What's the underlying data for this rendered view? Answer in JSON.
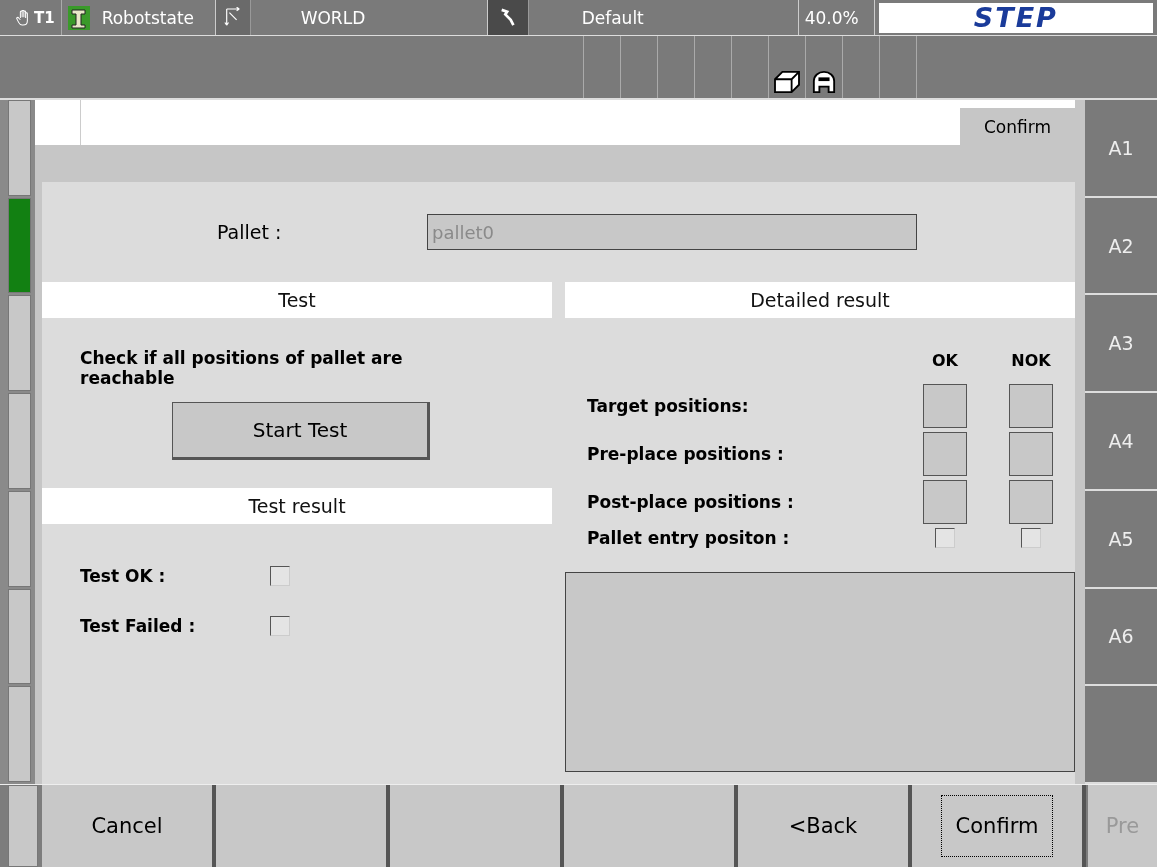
{
  "status_bar": {
    "mode": "T1",
    "robot_state": "Robotstate",
    "coordinate_system": "WORLD",
    "tool": "Default",
    "speed": "40.0%",
    "logo": "STEP"
  },
  "left_strip": [
    {
      "selected": false
    },
    {
      "selected": true
    },
    {
      "selected": false
    },
    {
      "selected": false
    },
    {
      "selected": false
    },
    {
      "selected": false
    },
    {
      "selected": false
    }
  ],
  "header": {
    "confirm_button": "Confirm"
  },
  "pallet": {
    "label": "Pallet :",
    "value": "pallet0",
    "disabled": true
  },
  "test": {
    "title": "Test",
    "description": "Check if all positions of pallet are reachable",
    "button": "Start Test",
    "result_title": "Test result",
    "results": [
      {
        "label": "Test OK :",
        "checked": false
      },
      {
        "label": "Test Failed :",
        "checked": false
      }
    ]
  },
  "detailed_result": {
    "title": "Detailed result",
    "columns": [
      "OK",
      "NOK"
    ],
    "rows": [
      {
        "label": "Target positions:",
        "kind": "large",
        "ok": false,
        "nok": false
      },
      {
        "label": "Pre-place positions :",
        "kind": "large",
        "ok": false,
        "nok": false
      },
      {
        "label": "Post-place positions :",
        "kind": "large",
        "ok": false,
        "nok": false
      },
      {
        "label": "Pallet entry positon :",
        "kind": "small",
        "ok": false,
        "nok": false
      }
    ]
  },
  "side_buttons": [
    {
      "label": "A1"
    },
    {
      "label": "A2"
    },
    {
      "label": "A3"
    },
    {
      "label": "A4"
    },
    {
      "label": "A5"
    },
    {
      "label": "A6"
    }
  ],
  "bottom_buttons": [
    {
      "label": "Cancel",
      "disabled": false,
      "focused": false
    },
    {
      "focused": false
    },
    {
      "focused": false
    },
    {
      "focused": false
    },
    {
      "label": "<Back",
      "disabled": false,
      "focused": false
    },
    {
      "label": "Confirm",
      "disabled": false,
      "focused": true
    },
    {
      "label": "Pre",
      "disabled": true,
      "focused": false
    }
  ]
}
